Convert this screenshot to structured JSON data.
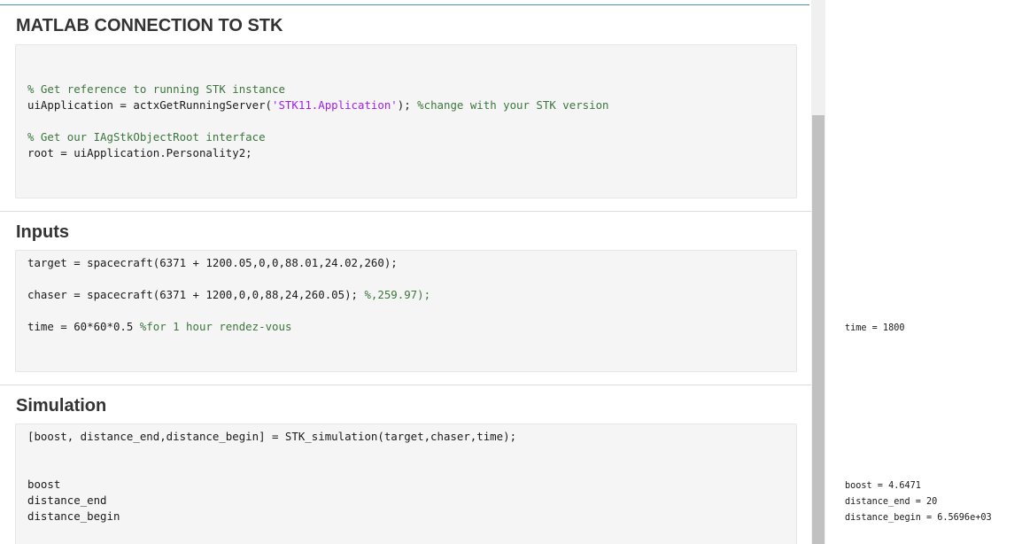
{
  "sections": [
    {
      "title": "MATLAB CONNECTION TO STK",
      "lines": [
        [
          {
            "text": "% Get reference to running STK instance",
            "kind": "comment"
          }
        ],
        [
          {
            "text": "uiApplication = actxGetRunningServer(",
            "kind": "code"
          },
          {
            "text": "'STK11.Application'",
            "kind": "string"
          },
          {
            "text": "); ",
            "kind": "code"
          },
          {
            "text": "%change with your STK version",
            "kind": "comment"
          }
        ],
        [
          {
            "text": "% Get our IAgStkObjectRoot interface",
            "kind": "comment"
          }
        ],
        [
          {
            "text": "root = uiApplication.Personality2;",
            "kind": "code"
          }
        ]
      ]
    },
    {
      "title": "Inputs",
      "lines": [
        [
          {
            "text": "target = spacecraft(6371 + 1200.05,0,0,88.01,24.02,260);",
            "kind": "code"
          }
        ],
        [
          {
            "text": "chaser = spacecraft(6371 + 1200,0,0,88,24,260.05); ",
            "kind": "code"
          },
          {
            "text": "%,259.97);",
            "kind": "comment"
          }
        ],
        [
          {
            "text": "time = 60*60*0.5 ",
            "kind": "code"
          },
          {
            "text": "%for 1 hour rendez-vous",
            "kind": "comment"
          }
        ]
      ]
    },
    {
      "title": "Simulation",
      "lines": [
        [
          {
            "text": "[boost, distance_end,distance_begin] = STK_simulation(target,chaser,time);",
            "kind": "code"
          }
        ],
        [
          {
            "text": "boost",
            "kind": "code"
          }
        ],
        [
          {
            "text": "distance_end",
            "kind": "code"
          }
        ],
        [
          {
            "text": "distance_begin",
            "kind": "code"
          }
        ]
      ]
    }
  ],
  "outputs": {
    "time": "time = 1800",
    "boost": "boost = 4.6471",
    "distance_end": "distance_end = 20",
    "distance_begin": "distance_begin = 6.5696e+03"
  }
}
